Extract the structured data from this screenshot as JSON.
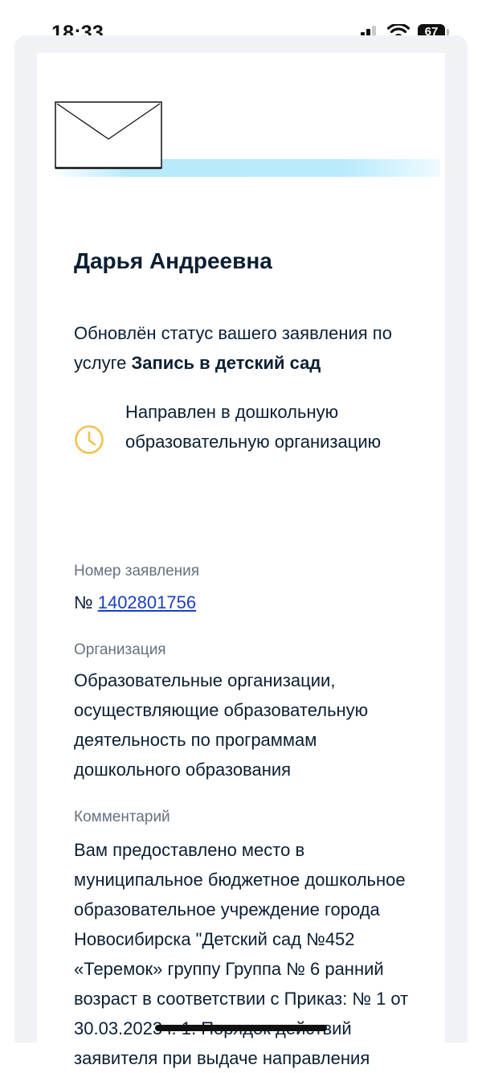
{
  "status_bar": {
    "time": "18:33",
    "battery": "67"
  },
  "email": {
    "greeting": "Дарья Андреевна",
    "intro_prefix": "Обновлён статус вашего заявления по услуге ",
    "service_name": "Запись в детский сад",
    "status_text": "Направлен в дошкольную образовательную организацию",
    "application_label": "Номер заявления",
    "application_prefix": "№ ",
    "application_number": "1402801756",
    "organization_label": "Организация",
    "organization_value": "Образовательные организации, осуществляющие образовательную деятельность по программам дошкольного образования",
    "comment_label": "Комментарий",
    "comment_value": "Вам предоставлено место в муниципальное бюджетное дошкольное образовательное учреждение города Новосибирска \"Детский сад №452 «Теремок» группу Группа № 6 ранний возраст в соответствии с Приказ: № 1 от 30.03.2023 г. 1. Порядок действий заявителя при выдаче направления"
  },
  "icons": {
    "status": "clock-icon",
    "header": "envelope-icon"
  },
  "colors": {
    "clock": "#f2c24e",
    "link": "#1c3fbf",
    "glow": "#b7eafb"
  }
}
